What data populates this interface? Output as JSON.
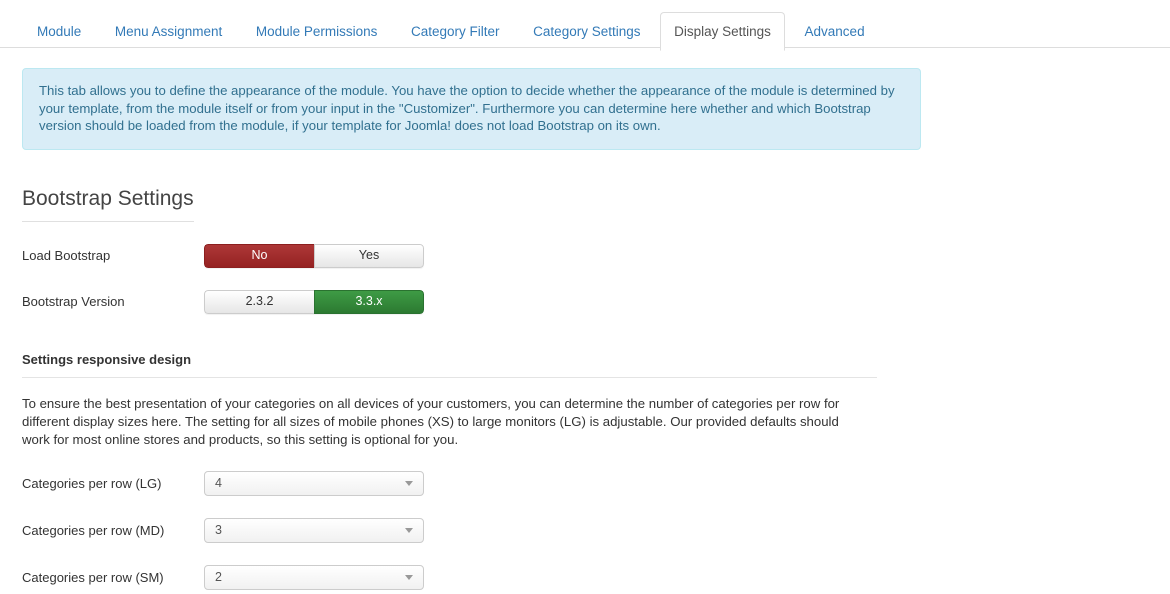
{
  "tabs": [
    {
      "label": "Module",
      "active": false
    },
    {
      "label": "Menu Assignment",
      "active": false
    },
    {
      "label": "Module Permissions",
      "active": false
    },
    {
      "label": "Category Filter",
      "active": false
    },
    {
      "label": "Category Settings",
      "active": false
    },
    {
      "label": "Display Settings",
      "active": true
    },
    {
      "label": "Advanced",
      "active": false
    }
  ],
  "alert": {
    "text": "This tab allows you to define the appearance of the module. You have the option to decide whether the appearance of the module is determined by your template, from the module itself or from your input in the \"Customizer\". Furthermore you can determine here whether and which Bootstrap version should be loaded from the module, if your template for Joomla! does not load Bootstrap on its own.",
    "background_color": "#d9edf7",
    "border_color": "#bce8f1",
    "text_color": "#31708f"
  },
  "bootstrap_section": {
    "title": "Bootstrap Settings",
    "load_bootstrap": {
      "label": "Load Bootstrap",
      "options": [
        "No",
        "Yes"
      ],
      "selected": "No",
      "active_color": "#952222"
    },
    "bootstrap_version": {
      "label": "Bootstrap Version",
      "options": [
        "2.3.2",
        "3.3.x"
      ],
      "selected": "3.3.x",
      "active_color": "#2c7a31"
    }
  },
  "responsive_section": {
    "title": "Settings responsive design",
    "description": "To ensure the best presentation of your categories on all devices of your customers, you can determine the number of categories per row for different display sizes here. The setting for all sizes of mobile phones (XS) to large monitors (LG) is adjustable. Our provided defaults should work for most online stores and products, so this setting is optional for you.",
    "fields": [
      {
        "label": "Categories per row (LG)",
        "value": "4"
      },
      {
        "label": "Categories per row (MD)",
        "value": "3"
      },
      {
        "label": "Categories per row (SM)",
        "value": "2"
      }
    ]
  }
}
